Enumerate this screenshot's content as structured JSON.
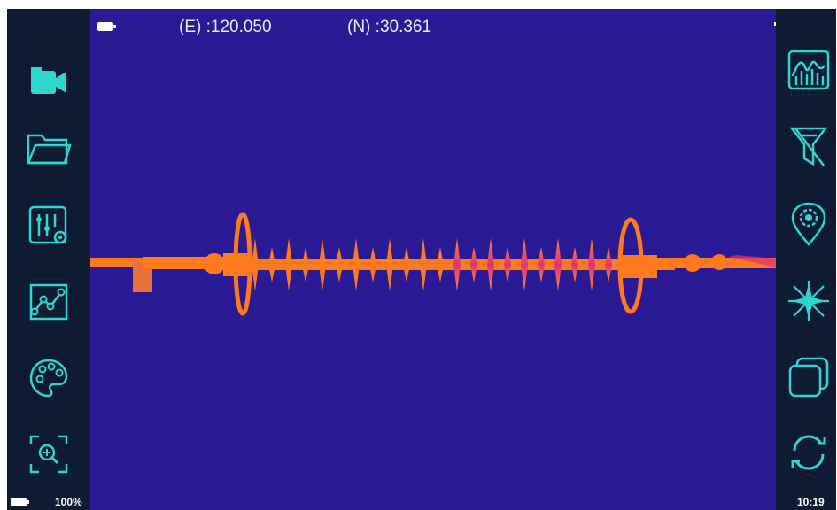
{
  "status_bar": {
    "easting_label": "(E)",
    "easting_value": ":120.050",
    "northing_label": "(N)",
    "northing_value": ":30.361",
    "battery_percent": "100%",
    "clock": "10:19"
  },
  "left_toolbar": {
    "items": [
      {
        "icon": "video-camera-icon"
      },
      {
        "icon": "folder-icon"
      },
      {
        "icon": "adjust-settings-icon"
      },
      {
        "icon": "trend-chart-icon"
      },
      {
        "icon": "palette-icon"
      },
      {
        "icon": "zoom-focus-icon"
      }
    ]
  },
  "right_toolbar": {
    "items": [
      {
        "icon": "histogram-icon"
      },
      {
        "icon": "filter-off-icon"
      },
      {
        "icon": "location-settings-icon"
      },
      {
        "icon": "laser-icon"
      },
      {
        "icon": "layers-icon"
      },
      {
        "icon": "refresh-icon"
      }
    ]
  },
  "colors": {
    "accent": "#2fd6d0",
    "viewport_background": "#2a1a96",
    "hot_orange": "#ff7a1c",
    "hot_magenta": "#e0307a",
    "sidebar": "#0f1a33"
  }
}
